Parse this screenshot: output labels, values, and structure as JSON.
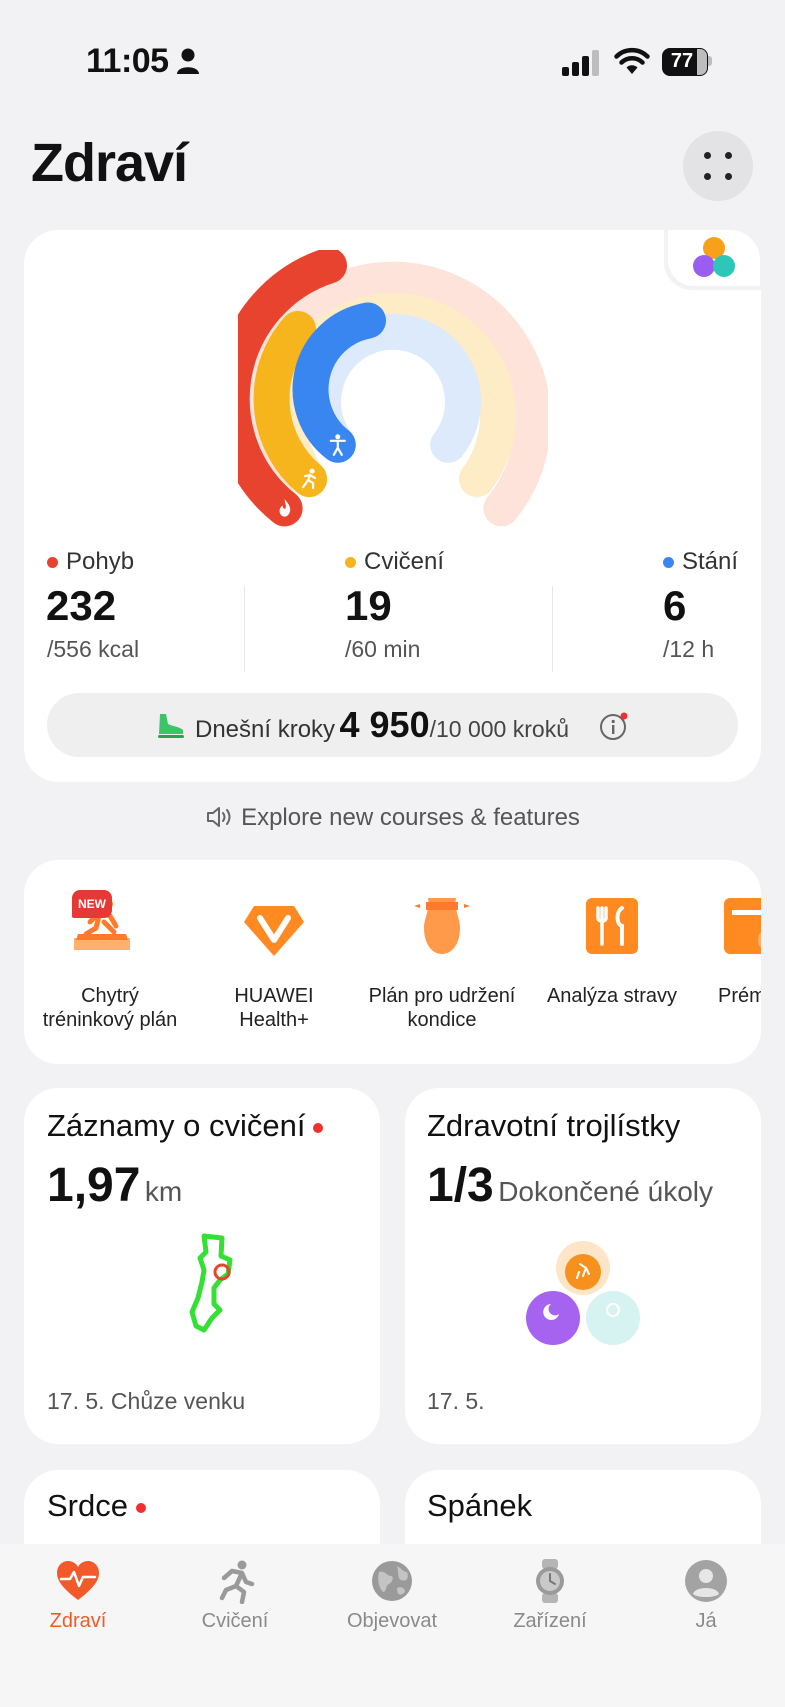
{
  "status_bar": {
    "time": "11:05",
    "battery": "77"
  },
  "header": {
    "title": "Zdraví"
  },
  "activity": {
    "move": {
      "label": "Pohyb",
      "value": "232",
      "goal": "/556 kcal",
      "color": "#e8432f",
      "progress": 0.42
    },
    "exercise": {
      "label": "Cvičení",
      "value": "19",
      "goal": "/60 min",
      "color": "#f7b51d",
      "progress": 0.32
    },
    "stand": {
      "label": "Stání",
      "value": "6",
      "goal": "/12 h",
      "color": "#3a86f0",
      "progress": 0.5
    }
  },
  "steps": {
    "label": "Dnešní kroky",
    "value": "4 950",
    "goal": "/10 000 kroků"
  },
  "explore": {
    "text": "Explore new courses & features"
  },
  "shortcuts": [
    {
      "line1": "Chytrý",
      "line2": "tréninkový plán",
      "badge": "NEW",
      "icon": "running-plan-icon"
    },
    {
      "line1": "HUAWEI",
      "line2": "Health+",
      "icon": "diamond-v-icon"
    },
    {
      "line1": "Plán pro udržení",
      "line2": "kondice",
      "icon": "body-shape-icon"
    },
    {
      "line1": "Analýza stravy",
      "line2": "",
      "icon": "fork-knife-icon"
    },
    {
      "line1": "Prémiov",
      "line2": "",
      "icon": "premium-icon"
    }
  ],
  "tiles": {
    "workout": {
      "title": "Záznamy o cvičení",
      "value": "1,97",
      "unit": "km",
      "footer": "17. 5. Chůze venku"
    },
    "clover": {
      "title": "Zdravotní trojlístky",
      "value": "1/3",
      "unit": "Dokončené úkoly",
      "footer": "17. 5."
    },
    "heart": {
      "title": "Srdce"
    },
    "sleep": {
      "title": "Spánek"
    }
  },
  "nav": [
    {
      "label": "Zdraví",
      "icon": "heart-rate-icon",
      "active": true
    },
    {
      "label": "Cvičení",
      "icon": "runner-icon",
      "active": false
    },
    {
      "label": "Objevovat",
      "icon": "globe-icon",
      "active": false
    },
    {
      "label": "Zařízení",
      "icon": "watch-icon",
      "active": false
    },
    {
      "label": "Já",
      "icon": "profile-icon",
      "active": false
    }
  ]
}
